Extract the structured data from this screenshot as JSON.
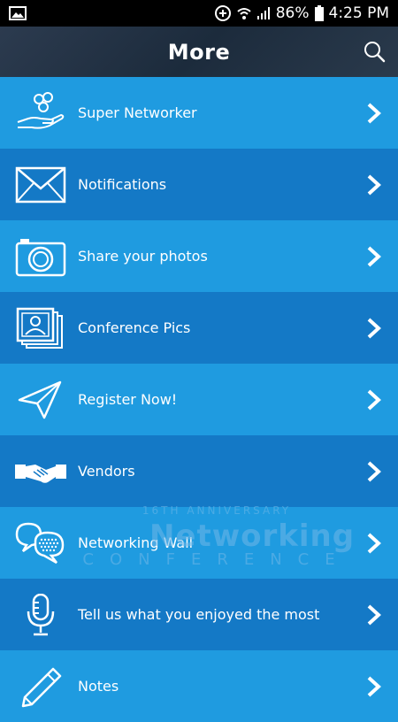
{
  "status_bar": {
    "battery": "86%",
    "time": "4:25 PM"
  },
  "header": {
    "title": "More"
  },
  "menu": {
    "items": [
      {
        "label": "Super Networker",
        "icon": "hand-coins-icon"
      },
      {
        "label": "Notifications",
        "icon": "envelope-icon"
      },
      {
        "label": "Share your photos",
        "icon": "camera-icon"
      },
      {
        "label": "Conference Pics",
        "icon": "photo-stack-icon"
      },
      {
        "label": "Register Now!",
        "icon": "paper-plane-icon"
      },
      {
        "label": "Vendors",
        "icon": "handshake-icon"
      },
      {
        "label": "Networking Wall",
        "icon": "chat-bubbles-icon"
      },
      {
        "label": "Tell us what you enjoyed the most",
        "icon": "microphone-icon"
      },
      {
        "label": "Notes",
        "icon": "pencil-icon"
      }
    ]
  },
  "watermark": {
    "top": "16TH ANNIVERSARY",
    "main": "Networking",
    "sub": "CONFERENCE"
  },
  "colors": {
    "row_light": "#1f9be0",
    "row_dark": "#1479c6",
    "header": "#1c2b3c"
  }
}
